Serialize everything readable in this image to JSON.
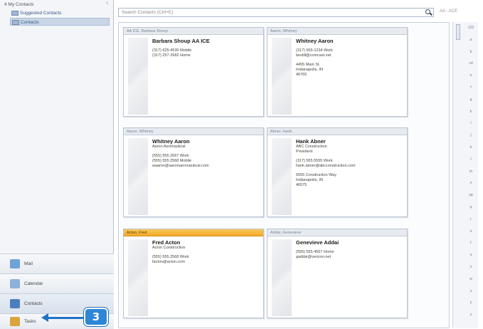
{
  "nav": {
    "header": "4 My Contacts",
    "folders": [
      {
        "label": "Suggested Contacts",
        "selected": false
      },
      {
        "label": "Contacts",
        "selected": true
      }
    ],
    "buttons": [
      {
        "label": "Mail",
        "icon": "mail-icon",
        "color": "#6fa3d8"
      },
      {
        "label": "Calendar",
        "icon": "calendar-icon",
        "color": "#8fb0d9"
      },
      {
        "label": "Contacts",
        "icon": "contacts-icon",
        "color": "#4d7fbd"
      },
      {
        "label": "Tasks",
        "icon": "tasks-icon",
        "color": "#d9a53c"
      }
    ]
  },
  "callout": {
    "number": "3"
  },
  "search": {
    "placeholder": "Search Contacts (Ctrl+E)",
    "scope": "AA - ACE"
  },
  "cards": [
    {
      "header": "AA ICE, Barbara Shoup",
      "name": "Barbara Shoup AA ICE",
      "selected": false,
      "lines": [
        "(317) 625-4530 Mobile",
        "(317) 257-2682 Home"
      ]
    },
    {
      "header": "Aaron, Whitney",
      "name": "Whitney Aaron",
      "selected": false,
      "lines": [
        "(317) 555-1234 Work",
        "bestill@comcast.net",
        "",
        "4455 Main St.",
        "Indianapolis, IN",
        "46765"
      ]
    },
    {
      "header": "Aaron, Whitney",
      "name": "Whitney Aaron",
      "selected": false,
      "lines": [
        "Aaron Aeronautical",
        "",
        "(555) 555.2667 Work",
        "(555) 555.2568 Mobile",
        "waaron@aaronaeronautical.com"
      ]
    },
    {
      "header": "Abner, Hank",
      "name": "Hank Abner",
      "selected": false,
      "lines": [
        "ABC Construction",
        "President",
        "",
        "(317) 555.5555 Work",
        "hank.abner@abcconstruction.com",
        "",
        "5555 Construction Way",
        "Indianapolis, IN",
        "46575"
      ]
    },
    {
      "header": "Acton, Fred",
      "name": "Fred Acton",
      "selected": true,
      "lines": [
        "Acton Construction",
        "",
        "(555) 555.2568 Work",
        "facton@acton.com"
      ]
    },
    {
      "header": "Addai, Genevieve",
      "name": "Genevieve Addai",
      "selected": false,
      "lines": [
        "(555) 555.4567 Home",
        "gaddai@verizon.net"
      ]
    }
  ],
  "alphabet": [
    "123",
    "a",
    "b",
    "cd",
    "e",
    "f",
    "g",
    "h",
    "i",
    "j",
    "k",
    "l",
    "m",
    "n",
    "op",
    "q",
    "r",
    "s",
    "t",
    "u",
    "v",
    "w",
    "x",
    "y",
    "z"
  ]
}
